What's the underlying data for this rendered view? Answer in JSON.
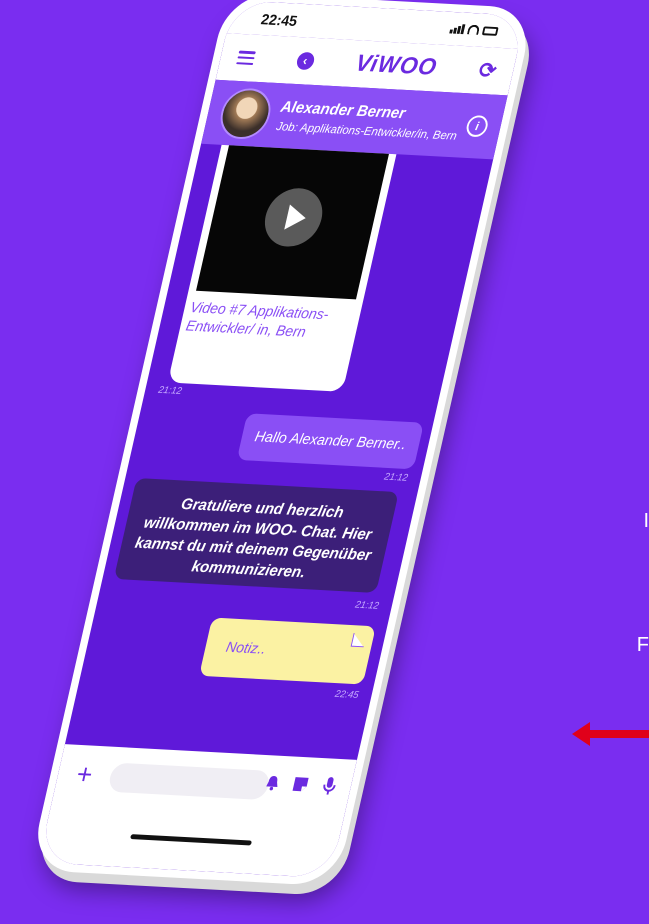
{
  "status": {
    "time": "22:45"
  },
  "header": {
    "logo": "ViWOO"
  },
  "profile": {
    "name": "Alexander Berner",
    "job": "Job: Applikations-Entwickler/in, Bern"
  },
  "messages": {
    "video": {
      "caption": "Video #7 Applikations-Entwickler/ in, Bern",
      "time": "21:12"
    },
    "outgoing": {
      "text": "Hallo Alexander Berner..",
      "time": "21:12"
    },
    "incoming": {
      "text": "Gratuliere und herzlich willkommen im WOO- Chat. Hier kannst du mit deinem Gegenüber kommunizieren.",
      "time": "21:12"
    },
    "note": {
      "text": "Notiz..",
      "time": "22:45"
    }
  },
  "composer": {
    "placeholder": ""
  },
  "background": {
    "label_1": "I",
    "label_2": "F"
  },
  "colors": {
    "accent": "#8a4ff5",
    "background": "#7a2df0",
    "note": "#fbf2a3",
    "arrow": "#e0001a"
  },
  "icons": [
    "menu-icon",
    "back-icon",
    "refresh-icon",
    "info-icon",
    "play-icon",
    "plus-icon",
    "bell-icon",
    "sticky-note-icon",
    "mic-icon",
    "arrow-left-icon"
  ]
}
